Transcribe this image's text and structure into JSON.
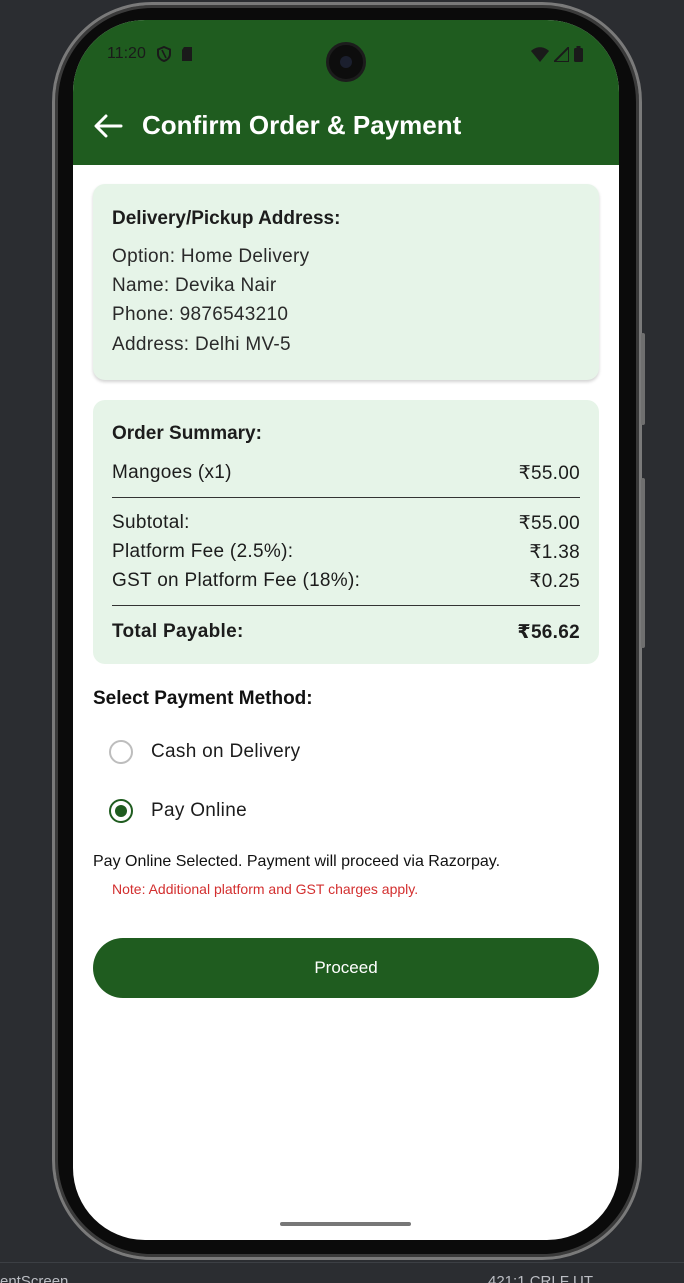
{
  "status_bar": {
    "time": "11:20"
  },
  "app_bar": {
    "title": "Confirm Order & Payment"
  },
  "address_card": {
    "heading": "Delivery/Pickup Address:",
    "option": "Option: Home Delivery",
    "name": "Name: Devika Nair",
    "phone": "Phone: 9876543210",
    "address": "Address: Delhi MV-5"
  },
  "order_summary": {
    "heading": "Order Summary:",
    "items": [
      {
        "label": "Mangoes (x1)",
        "amount": "₹55.00"
      }
    ],
    "subtotal": {
      "label": "Subtotal:",
      "amount": "₹55.00"
    },
    "platform_fee": {
      "label": "Platform Fee (2.5%):",
      "amount": "₹1.38"
    },
    "gst": {
      "label": "GST on Platform Fee (18%):",
      "amount": "₹0.25"
    },
    "total": {
      "label": "Total Payable:",
      "amount": "₹56.62"
    }
  },
  "payment": {
    "heading": "Select Payment Method:",
    "options": [
      {
        "label": "Cash on Delivery",
        "selected": false
      },
      {
        "label": "Pay Online",
        "selected": true
      }
    ],
    "info": "Pay Online Selected. Payment will proceed via Razorpay.",
    "note": "Note: Additional platform and GST charges apply."
  },
  "proceed_label": "Proceed",
  "ide": {
    "left_text": "entScreen",
    "right_text": "421:1     CRLF     UT"
  },
  "colors": {
    "primary": "#1f5c1f",
    "card_bg": "#e6f4e8",
    "note_red": "#d32f2f"
  }
}
